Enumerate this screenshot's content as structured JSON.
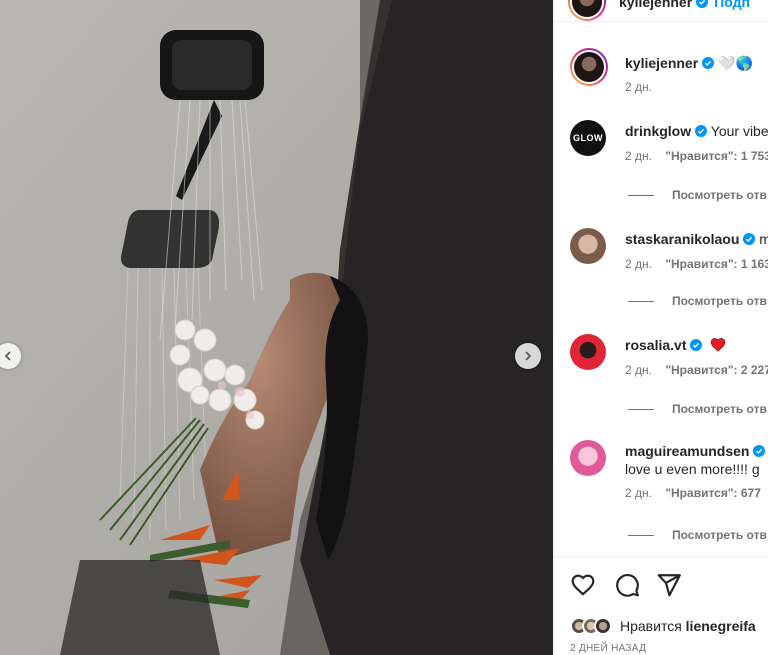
{
  "post": {
    "author": "kyliejenner",
    "follow_label": "Подп"
  },
  "caption": {
    "username": "kyliejenner",
    "emoji": "🤍🌎",
    "time": "2 дн."
  },
  "comments": [
    {
      "username": "drinkglow",
      "avatar_text": "GLOW",
      "text": "Your vibe",
      "time": "2 дн.",
      "likes": "\"Нравится\": 1 753",
      "replies": "Посмотреть отв"
    },
    {
      "username": "staskaranikolaou",
      "text": "m",
      "time": "2 дн.",
      "likes": "\"Нравится\": 1 163",
      "replies": "Посмотреть отв"
    },
    {
      "username": "rosalia.vt",
      "text": "",
      "time": "2 дн.",
      "likes": "\"Нравится\": 2 227",
      "replies": "Посмотреть отв"
    },
    {
      "username": "maguireamundsen",
      "text": "love u even more!!!! g",
      "time": "2 дн.",
      "likes": "\"Нравится\": 677",
      "replies": "Посмотреть отв"
    }
  ],
  "actions": {
    "liked_prefix": "Нравится",
    "liked_user": "lienegreifa",
    "ago": "2 ДНЕЙ НАЗАД"
  },
  "icons": [
    "chevron-left-icon",
    "chevron-right-icon",
    "verified-badge-icon",
    "heart-icon",
    "comment-icon",
    "share-icon"
  ],
  "colors": {
    "link": "#0095f6",
    "verified": "#0095f6",
    "heart_red": "#ed1c24",
    "muted": "#737373"
  }
}
